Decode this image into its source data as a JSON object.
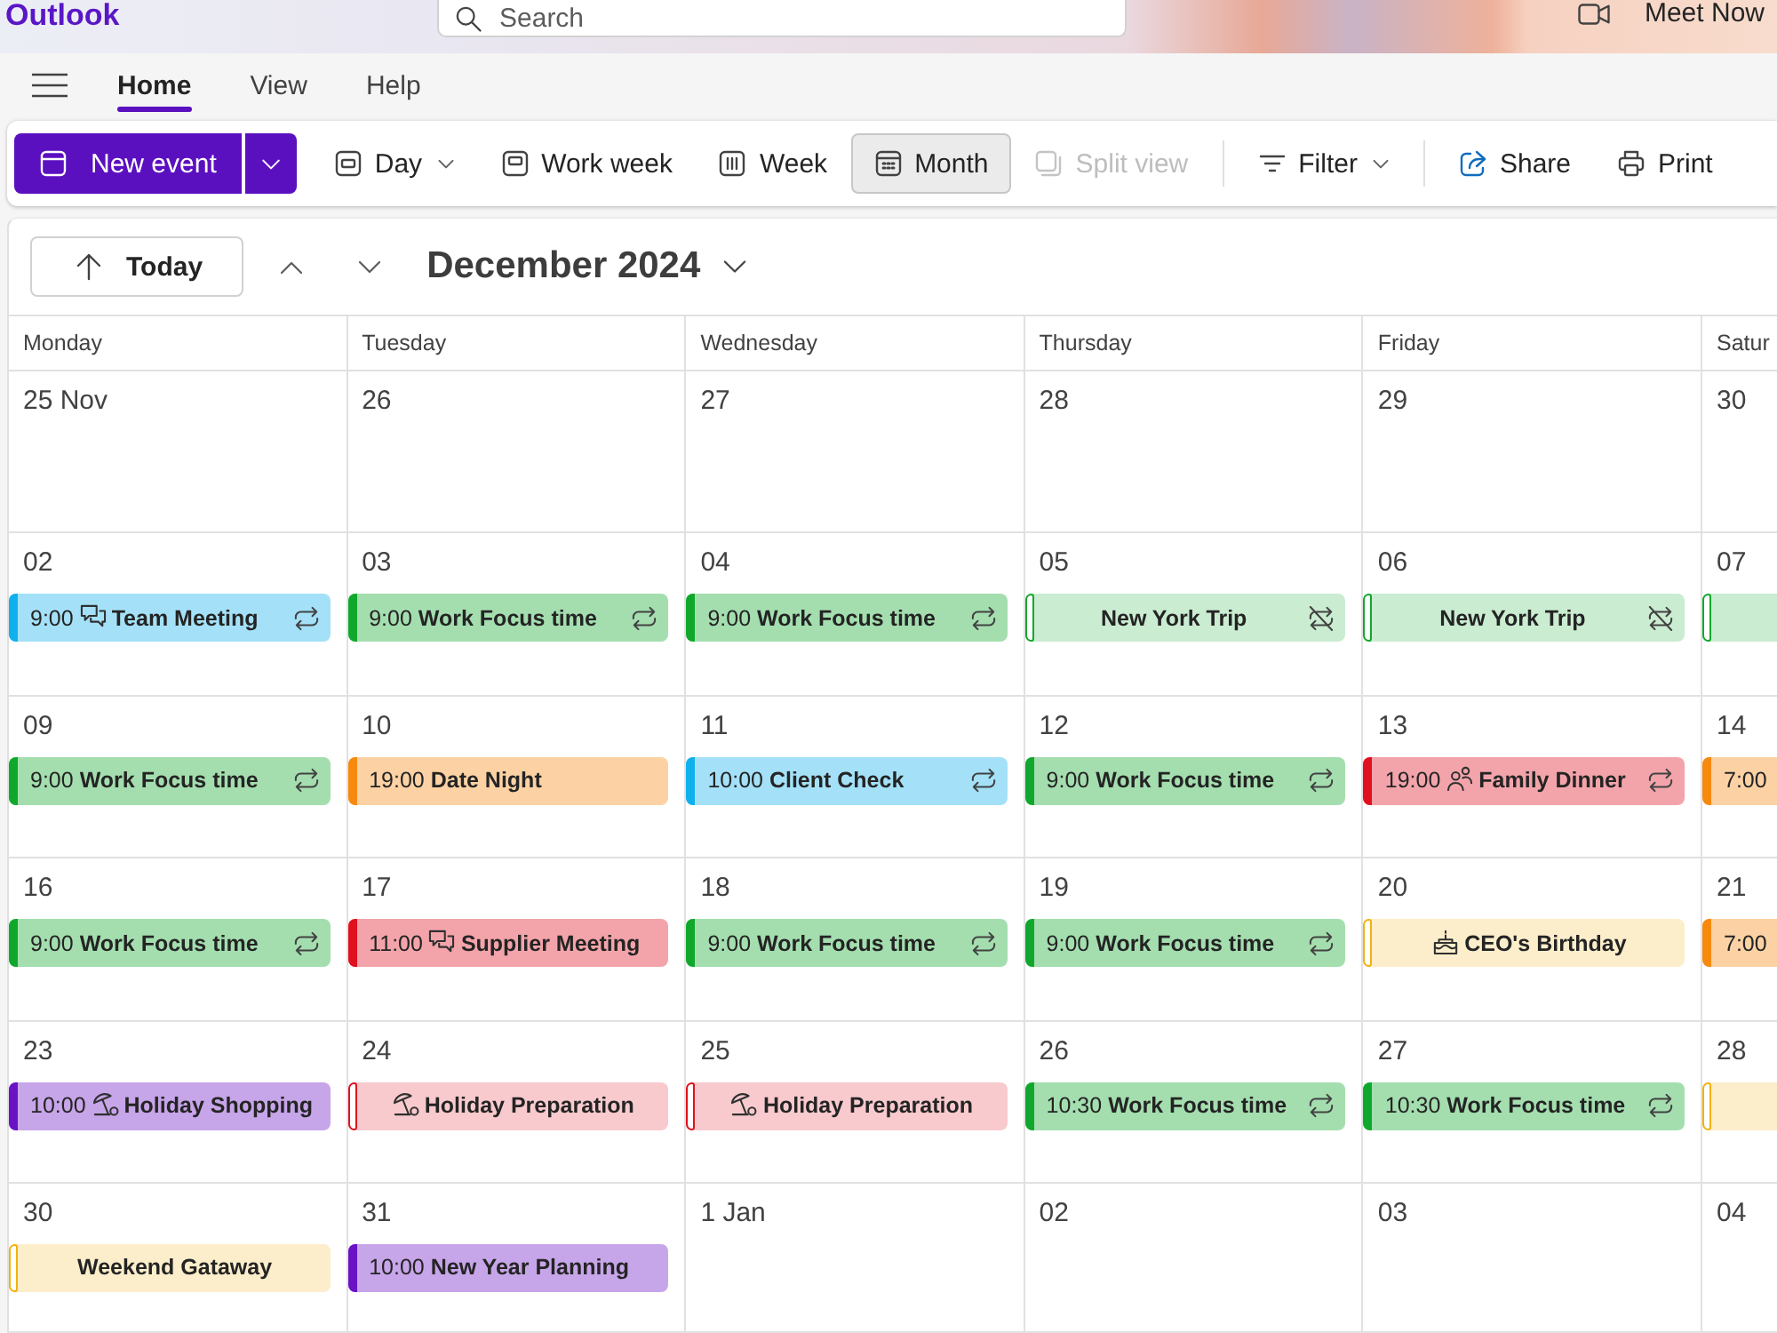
{
  "app": {
    "name": "Outlook"
  },
  "search": {
    "placeholder": "Search"
  },
  "meet_now": {
    "label": "Meet Now"
  },
  "ribbon_tabs": [
    {
      "label": "Home",
      "selected": true
    },
    {
      "label": "View",
      "selected": false
    },
    {
      "label": "Help",
      "selected": false
    }
  ],
  "toolbar": {
    "new_event": {
      "label": "New event"
    },
    "groups": [
      [
        {
          "kind": "day",
          "label": "Day",
          "dropdown": true,
          "selected": false,
          "disabled": false
        },
        {
          "kind": "work_week",
          "label": "Work week",
          "dropdown": false,
          "selected": false,
          "disabled": false
        },
        {
          "kind": "week",
          "label": "Week",
          "dropdown": false,
          "selected": false,
          "disabled": false
        },
        {
          "kind": "month",
          "label": "Month",
          "dropdown": false,
          "selected": true,
          "disabled": false
        },
        {
          "kind": "split_view",
          "label": "Split view",
          "dropdown": false,
          "selected": false,
          "disabled": true
        }
      ],
      [
        {
          "kind": "filter",
          "label": "Filter",
          "dropdown": true
        }
      ],
      [
        {
          "kind": "share",
          "label": "Share",
          "dropdown": false
        },
        {
          "kind": "print",
          "label": "Print",
          "dropdown": false
        }
      ]
    ]
  },
  "calendar": {
    "today_button": "Today",
    "month_title": "December 2024",
    "weekdays": [
      "Monday",
      "Tuesday",
      "Wednesday",
      "Thursday",
      "Friday",
      "Satur"
    ],
    "weeks": [
      {
        "days": [
          {
            "date": "25 Nov"
          },
          {
            "date": "26"
          },
          {
            "date": "27"
          },
          {
            "date": "28"
          },
          {
            "date": "29"
          },
          {
            "date": "30"
          }
        ]
      },
      {
        "days": [
          {
            "date": "02",
            "events": [
              {
                "kind": "chat",
                "all_day": false,
                "time": "9:00",
                "title": "Team Meeting",
                "recurring": true,
                "exception": false,
                "color": "#0fb0ec"
              }
            ]
          },
          {
            "date": "03",
            "events": [
              {
                "kind": "plain",
                "all_day": false,
                "time": "9:00",
                "title": "Work Focus time",
                "recurring": true,
                "exception": false,
                "color": "#10a82c"
              }
            ]
          },
          {
            "date": "04",
            "events": [
              {
                "kind": "plain",
                "all_day": false,
                "time": "9:00",
                "title": "Work Focus time",
                "recurring": true,
                "exception": false,
                "color": "#10a82c"
              }
            ]
          },
          {
            "date": "05",
            "events": [
              {
                "kind": "plain",
                "all_day": true,
                "title": "New York Trip",
                "recurring": false,
                "exception": true,
                "color": "#10a82c"
              }
            ]
          },
          {
            "date": "06",
            "events": [
              {
                "kind": "plain",
                "all_day": true,
                "title": "New York Trip",
                "recurring": false,
                "exception": true,
                "color": "#10a82c"
              }
            ]
          },
          {
            "date": "07",
            "events": [
              {
                "kind": "plain",
                "all_day": true,
                "recurring": false,
                "exception": false,
                "color": "#10a82c"
              }
            ]
          }
        ]
      },
      {
        "days": [
          {
            "date": "09",
            "events": [
              {
                "kind": "plain",
                "all_day": false,
                "time": "9:00",
                "title": "Work Focus time",
                "recurring": true,
                "exception": false,
                "color": "#10a82c"
              }
            ]
          },
          {
            "date": "10",
            "events": [
              {
                "kind": "plain",
                "all_day": false,
                "time": "19:00",
                "title": "Date Night",
                "recurring": false,
                "exception": false,
                "color": "#f7890f"
              }
            ]
          },
          {
            "date": "11",
            "events": [
              {
                "kind": "plain",
                "all_day": false,
                "time": "10:00",
                "title": "Client Check",
                "recurring": true,
                "exception": false,
                "color": "#0fb0ec"
              }
            ]
          },
          {
            "date": "12",
            "events": [
              {
                "kind": "plain",
                "all_day": false,
                "time": "9:00",
                "title": "Work Focus time",
                "recurring": true,
                "exception": false,
                "color": "#10a82c"
              }
            ]
          },
          {
            "date": "13",
            "events": [
              {
                "kind": "people",
                "all_day": false,
                "time": "19:00",
                "title": "Family Dinner",
                "recurring": true,
                "exception": false,
                "color": "#e0101e"
              }
            ]
          },
          {
            "date": "14",
            "events": [
              {
                "kind": "plain",
                "all_day": false,
                "time": "7:00",
                "recurring": false,
                "exception": false,
                "color": "#f7890f"
              }
            ]
          }
        ]
      },
      {
        "days": [
          {
            "date": "16",
            "events": [
              {
                "kind": "plain",
                "all_day": false,
                "time": "9:00",
                "title": "Work Focus time",
                "recurring": true,
                "exception": false,
                "color": "#10a82c"
              }
            ]
          },
          {
            "date": "17",
            "events": [
              {
                "kind": "chat",
                "all_day": false,
                "time": "11:00",
                "title": "Supplier Meeting",
                "recurring": false,
                "exception": false,
                "color": "#e0101e"
              }
            ]
          },
          {
            "date": "18",
            "events": [
              {
                "kind": "plain",
                "all_day": false,
                "time": "9:00",
                "title": "Work Focus time",
                "recurring": true,
                "exception": false,
                "color": "#10a82c"
              }
            ]
          },
          {
            "date": "19",
            "events": [
              {
                "kind": "plain",
                "all_day": false,
                "time": "9:00",
                "title": "Work Focus time",
                "recurring": true,
                "exception": false,
                "color": "#10a82c"
              }
            ]
          },
          {
            "date": "20",
            "events": [
              {
                "kind": "cake",
                "all_day": true,
                "title": "CEO's Birthday",
                "recurring": false,
                "exception": false,
                "color": "#f2b111"
              }
            ]
          },
          {
            "date": "21",
            "events": [
              {
                "kind": "plain",
                "all_day": false,
                "time": "7:00",
                "recurring": false,
                "exception": false,
                "color": "#f7890f"
              }
            ]
          }
        ]
      },
      {
        "days": [
          {
            "date": "23",
            "events": [
              {
                "kind": "beach",
                "all_day": false,
                "time": "10:00",
                "title": "Holiday Shopping",
                "recurring": false,
                "exception": false,
                "color": "#6b12c4"
              }
            ]
          },
          {
            "date": "24",
            "events": [
              {
                "kind": "beach",
                "all_day": true,
                "title": "Holiday Preparation",
                "recurring": false,
                "exception": false,
                "color": "#e0101e"
              }
            ]
          },
          {
            "date": "25",
            "events": [
              {
                "kind": "beach",
                "all_day": true,
                "title": "Holiday Preparation",
                "recurring": false,
                "exception": false,
                "color": "#e0101e"
              }
            ]
          },
          {
            "date": "26",
            "events": [
              {
                "kind": "plain",
                "all_day": false,
                "time": "10:30",
                "title": "Work Focus time",
                "recurring": true,
                "exception": false,
                "color": "#10a82c"
              }
            ]
          },
          {
            "date": "27",
            "events": [
              {
                "kind": "plain",
                "all_day": false,
                "time": "10:30",
                "title": "Work Focus time",
                "recurring": true,
                "exception": false,
                "color": "#10a82c"
              }
            ]
          },
          {
            "date": "28",
            "events": [
              {
                "kind": "plain",
                "all_day": true,
                "recurring": false,
                "exception": false,
                "color": "#f2b111"
              }
            ]
          }
        ]
      },
      {
        "days": [
          {
            "date": "30",
            "events": [
              {
                "kind": "plain",
                "all_day": true,
                "title": "Weekend Gataway",
                "recurring": false,
                "exception": false,
                "color": "#f2b111"
              }
            ]
          },
          {
            "date": "31",
            "events": [
              {
                "kind": "plain",
                "all_day": false,
                "time": "10:00",
                "title": "New Year Planning",
                "recurring": false,
                "exception": false,
                "color": "#6b12c4"
              }
            ]
          },
          {
            "date": "1 Jan"
          },
          {
            "date": "02"
          },
          {
            "date": "03"
          },
          {
            "date": "04"
          }
        ]
      }
    ]
  }
}
